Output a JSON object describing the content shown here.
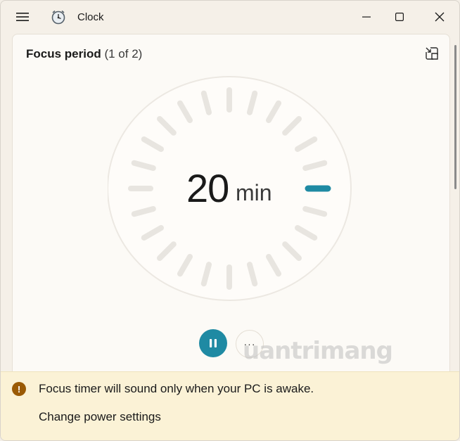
{
  "window": {
    "app_title": "Clock",
    "menu_icon": "hamburger-icon",
    "app_icon": "clock-app-icon",
    "controls": [
      "minimize-icon",
      "maximize-icon",
      "close-icon"
    ]
  },
  "focus": {
    "period_label": "Focus period",
    "period_count": "(1 of 2)",
    "compact_icon": "compact-overlay-icon",
    "time_value": "20",
    "time_unit": "min",
    "progress_fraction": 0.0,
    "accent_color": "#1f8aa3"
  },
  "controls": {
    "pause_icon": "pause-icon",
    "more_label": "···"
  },
  "watermark": {
    "text": "uantrimang"
  },
  "banner": {
    "icon": "warning-icon",
    "message": "Focus timer will sound only when your PC is awake.",
    "link_label": "Change power settings"
  }
}
